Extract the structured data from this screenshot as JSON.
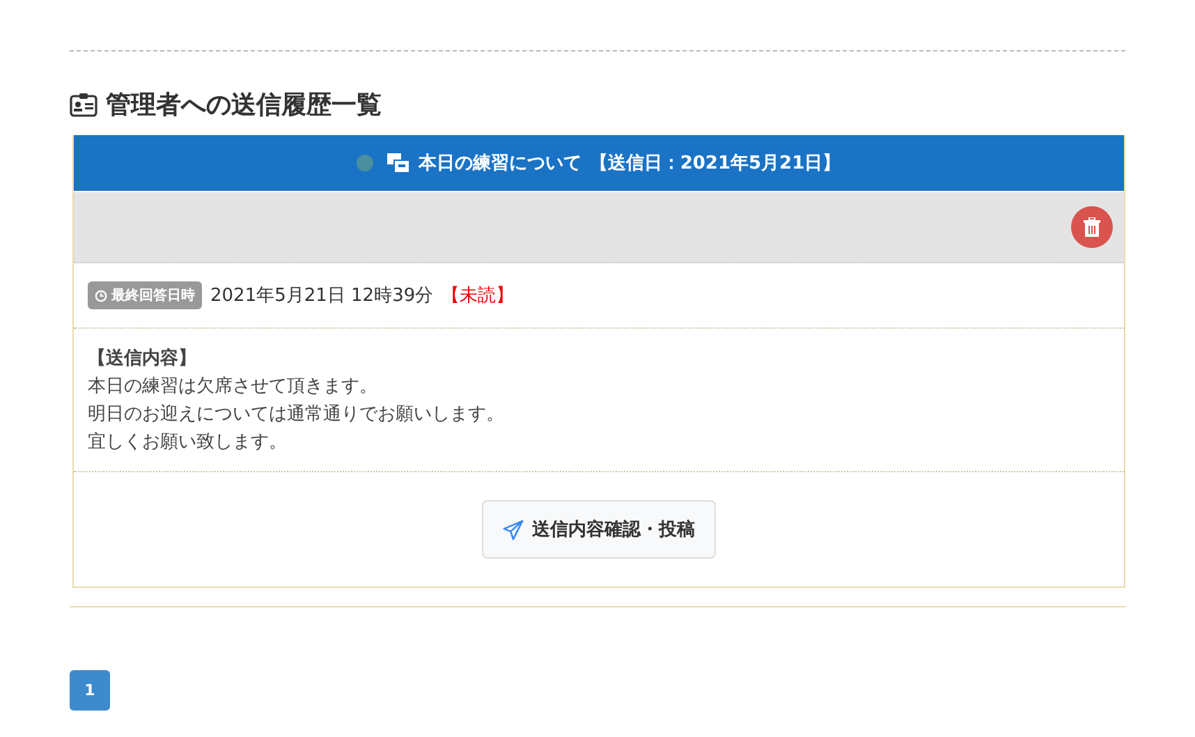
{
  "page_title": "管理者への送信履歴一覧",
  "messages": [
    {
      "subject": "本日の練習について",
      "sent_date": "【送信日：2021年5月21日】",
      "last_reply_label": "最終回答日時",
      "last_reply_time": "2021年5月21日 12時39分",
      "read_status": "【未読】",
      "content_heading": "【送信内容】",
      "content_lines": [
        "本日の練習は欠席させて頂きます。",
        "明日のお迎えについては通常通りでお願いします。",
        "宜しくお願い致します。"
      ],
      "action_button": "送信内容確認・投稿"
    }
  ],
  "pagination": [
    {
      "label": "1",
      "selected": true
    }
  ]
}
